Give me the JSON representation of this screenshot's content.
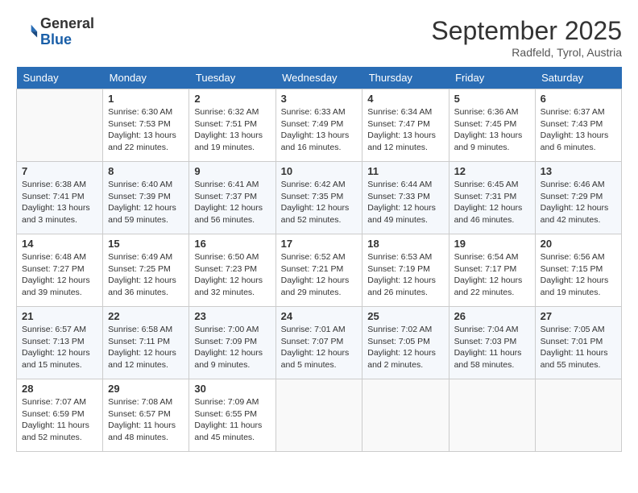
{
  "logo": {
    "line1": "General",
    "line2": "Blue"
  },
  "title": "September 2025",
  "location": "Radfeld, Tyrol, Austria",
  "weekdays": [
    "Sunday",
    "Monday",
    "Tuesday",
    "Wednesday",
    "Thursday",
    "Friday",
    "Saturday"
  ],
  "weeks": [
    [
      {
        "day": "",
        "sunrise": "",
        "sunset": "",
        "daylight": ""
      },
      {
        "day": "1",
        "sunrise": "Sunrise: 6:30 AM",
        "sunset": "Sunset: 7:53 PM",
        "daylight": "Daylight: 13 hours and 22 minutes."
      },
      {
        "day": "2",
        "sunrise": "Sunrise: 6:32 AM",
        "sunset": "Sunset: 7:51 PM",
        "daylight": "Daylight: 13 hours and 19 minutes."
      },
      {
        "day": "3",
        "sunrise": "Sunrise: 6:33 AM",
        "sunset": "Sunset: 7:49 PM",
        "daylight": "Daylight: 13 hours and 16 minutes."
      },
      {
        "day": "4",
        "sunrise": "Sunrise: 6:34 AM",
        "sunset": "Sunset: 7:47 PM",
        "daylight": "Daylight: 13 hours and 12 minutes."
      },
      {
        "day": "5",
        "sunrise": "Sunrise: 6:36 AM",
        "sunset": "Sunset: 7:45 PM",
        "daylight": "Daylight: 13 hours and 9 minutes."
      },
      {
        "day": "6",
        "sunrise": "Sunrise: 6:37 AM",
        "sunset": "Sunset: 7:43 PM",
        "daylight": "Daylight: 13 hours and 6 minutes."
      }
    ],
    [
      {
        "day": "7",
        "sunrise": "Sunrise: 6:38 AM",
        "sunset": "Sunset: 7:41 PM",
        "daylight": "Daylight: 13 hours and 3 minutes."
      },
      {
        "day": "8",
        "sunrise": "Sunrise: 6:40 AM",
        "sunset": "Sunset: 7:39 PM",
        "daylight": "Daylight: 12 hours and 59 minutes."
      },
      {
        "day": "9",
        "sunrise": "Sunrise: 6:41 AM",
        "sunset": "Sunset: 7:37 PM",
        "daylight": "Daylight: 12 hours and 56 minutes."
      },
      {
        "day": "10",
        "sunrise": "Sunrise: 6:42 AM",
        "sunset": "Sunset: 7:35 PM",
        "daylight": "Daylight: 12 hours and 52 minutes."
      },
      {
        "day": "11",
        "sunrise": "Sunrise: 6:44 AM",
        "sunset": "Sunset: 7:33 PM",
        "daylight": "Daylight: 12 hours and 49 minutes."
      },
      {
        "day": "12",
        "sunrise": "Sunrise: 6:45 AM",
        "sunset": "Sunset: 7:31 PM",
        "daylight": "Daylight: 12 hours and 46 minutes."
      },
      {
        "day": "13",
        "sunrise": "Sunrise: 6:46 AM",
        "sunset": "Sunset: 7:29 PM",
        "daylight": "Daylight: 12 hours and 42 minutes."
      }
    ],
    [
      {
        "day": "14",
        "sunrise": "Sunrise: 6:48 AM",
        "sunset": "Sunset: 7:27 PM",
        "daylight": "Daylight: 12 hours and 39 minutes."
      },
      {
        "day": "15",
        "sunrise": "Sunrise: 6:49 AM",
        "sunset": "Sunset: 7:25 PM",
        "daylight": "Daylight: 12 hours and 36 minutes."
      },
      {
        "day": "16",
        "sunrise": "Sunrise: 6:50 AM",
        "sunset": "Sunset: 7:23 PM",
        "daylight": "Daylight: 12 hours and 32 minutes."
      },
      {
        "day": "17",
        "sunrise": "Sunrise: 6:52 AM",
        "sunset": "Sunset: 7:21 PM",
        "daylight": "Daylight: 12 hours and 29 minutes."
      },
      {
        "day": "18",
        "sunrise": "Sunrise: 6:53 AM",
        "sunset": "Sunset: 7:19 PM",
        "daylight": "Daylight: 12 hours and 26 minutes."
      },
      {
        "day": "19",
        "sunrise": "Sunrise: 6:54 AM",
        "sunset": "Sunset: 7:17 PM",
        "daylight": "Daylight: 12 hours and 22 minutes."
      },
      {
        "day": "20",
        "sunrise": "Sunrise: 6:56 AM",
        "sunset": "Sunset: 7:15 PM",
        "daylight": "Daylight: 12 hours and 19 minutes."
      }
    ],
    [
      {
        "day": "21",
        "sunrise": "Sunrise: 6:57 AM",
        "sunset": "Sunset: 7:13 PM",
        "daylight": "Daylight: 12 hours and 15 minutes."
      },
      {
        "day": "22",
        "sunrise": "Sunrise: 6:58 AM",
        "sunset": "Sunset: 7:11 PM",
        "daylight": "Daylight: 12 hours and 12 minutes."
      },
      {
        "day": "23",
        "sunrise": "Sunrise: 7:00 AM",
        "sunset": "Sunset: 7:09 PM",
        "daylight": "Daylight: 12 hours and 9 minutes."
      },
      {
        "day": "24",
        "sunrise": "Sunrise: 7:01 AM",
        "sunset": "Sunset: 7:07 PM",
        "daylight": "Daylight: 12 hours and 5 minutes."
      },
      {
        "day": "25",
        "sunrise": "Sunrise: 7:02 AM",
        "sunset": "Sunset: 7:05 PM",
        "daylight": "Daylight: 12 hours and 2 minutes."
      },
      {
        "day": "26",
        "sunrise": "Sunrise: 7:04 AM",
        "sunset": "Sunset: 7:03 PM",
        "daylight": "Daylight: 11 hours and 58 minutes."
      },
      {
        "day": "27",
        "sunrise": "Sunrise: 7:05 AM",
        "sunset": "Sunset: 7:01 PM",
        "daylight": "Daylight: 11 hours and 55 minutes."
      }
    ],
    [
      {
        "day": "28",
        "sunrise": "Sunrise: 7:07 AM",
        "sunset": "Sunset: 6:59 PM",
        "daylight": "Daylight: 11 hours and 52 minutes."
      },
      {
        "day": "29",
        "sunrise": "Sunrise: 7:08 AM",
        "sunset": "Sunset: 6:57 PM",
        "daylight": "Daylight: 11 hours and 48 minutes."
      },
      {
        "day": "30",
        "sunrise": "Sunrise: 7:09 AM",
        "sunset": "Sunset: 6:55 PM",
        "daylight": "Daylight: 11 hours and 45 minutes."
      },
      {
        "day": "",
        "sunrise": "",
        "sunset": "",
        "daylight": ""
      },
      {
        "day": "",
        "sunrise": "",
        "sunset": "",
        "daylight": ""
      },
      {
        "day": "",
        "sunrise": "",
        "sunset": "",
        "daylight": ""
      },
      {
        "day": "",
        "sunrise": "",
        "sunset": "",
        "daylight": ""
      }
    ]
  ]
}
